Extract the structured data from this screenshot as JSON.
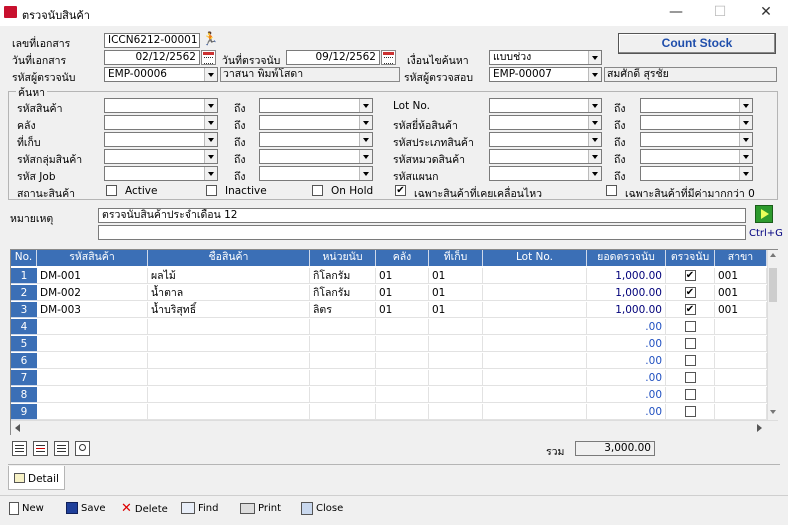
{
  "window": {
    "title": "ตรวจนับสินค้า",
    "minimize": "—",
    "maximize": "☐",
    "close": "✕"
  },
  "header": {
    "doc_no_label": "เลขที่เอกสาร",
    "doc_no": "ICCN6212-00001",
    "doc_date_label": "วันที่เอกสาร",
    "doc_date": "02/12/2562",
    "count_date_label": "วันที่ตรวจนับ",
    "count_date": "09/12/2562",
    "search_cond_label": "เงื่อนไขค้นหา",
    "search_cond": "แบบช่วง",
    "counter_label": "รหัสผู้ตรวจนับ",
    "counter_code": "EMP-00006",
    "counter_name": "วาสนา  พิมพ์โสดา",
    "checker_label": "รหัสผู้ตรวจสอบ",
    "checker_code": "EMP-00007",
    "checker_name": "สมศักดิ์  สุรชัย",
    "count_stock_button": "Count Stock"
  },
  "search": {
    "group_label": "ค้นหา",
    "to_label": "ถึง",
    "left_rows": [
      "รหัสสินค้า",
      "คลัง",
      "ที่เก็บ",
      "รหัสกลุ่มสินค้า",
      "รหัส Job"
    ],
    "right_rows": [
      "Lot No.",
      "รหัสยี่ห้อสินค้า",
      "รหัสประเภทสินค้า",
      "รหัสหมวดสินค้า",
      "รหัสแผนก"
    ],
    "status_label": "สถานะสินค้า",
    "checks": [
      {
        "label": "Active",
        "checked": false
      },
      {
        "label": "Inactive",
        "checked": false
      },
      {
        "label": "On Hold",
        "checked": false
      },
      {
        "label": "เฉพาะสินค้าที่เคยเคลื่อนไหว",
        "checked": true
      },
      {
        "label": "เฉพาะสินค้าที่มีค่ามากกว่า 0",
        "checked": false
      }
    ]
  },
  "remark": {
    "label": "หมายเหตุ",
    "line1": "ตรวจนับสินค้าประจำเดือน 12",
    "line2": "",
    "shortcut": "Ctrl+G"
  },
  "grid": {
    "columns": [
      "No.",
      "รหัสสินค้า",
      "ชื่อสินค้า",
      "หน่วยนับ",
      "คลัง",
      "ที่เก็บ",
      "Lot No.",
      "ยอดตรวจนับ",
      "ตรวจนับ",
      "สาขา"
    ],
    "rows": [
      {
        "no": "1",
        "code": "DM-001",
        "name": "ผลไม้",
        "unit": "กิโลกรัม",
        "wh": "01",
        "loc": "01",
        "lot": "",
        "qty": "1,000.00",
        "checked": true,
        "branch": "001"
      },
      {
        "no": "2",
        "code": "DM-002",
        "name": "น้ำตาล",
        "unit": "กิโลกรัม",
        "wh": "01",
        "loc": "01",
        "lot": "",
        "qty": "1,000.00",
        "checked": true,
        "branch": "001"
      },
      {
        "no": "3",
        "code": "DM-003",
        "name": "น้ำบริสุทธิ์",
        "unit": "ลิตร",
        "wh": "01",
        "loc": "01",
        "lot": "",
        "qty": "1,000.00",
        "checked": true,
        "branch": "001"
      },
      {
        "no": "4",
        "code": "",
        "name": "",
        "unit": "",
        "wh": "",
        "loc": "",
        "lot": "",
        "qty": ".00",
        "checked": false,
        "branch": ""
      },
      {
        "no": "5",
        "code": "",
        "name": "",
        "unit": "",
        "wh": "",
        "loc": "",
        "lot": "",
        "qty": ".00",
        "checked": false,
        "branch": ""
      },
      {
        "no": "6",
        "code": "",
        "name": "",
        "unit": "",
        "wh": "",
        "loc": "",
        "lot": "",
        "qty": ".00",
        "checked": false,
        "branch": ""
      },
      {
        "no": "7",
        "code": "",
        "name": "",
        "unit": "",
        "wh": "",
        "loc": "",
        "lot": "",
        "qty": ".00",
        "checked": false,
        "branch": ""
      },
      {
        "no": "8",
        "code": "",
        "name": "",
        "unit": "",
        "wh": "",
        "loc": "",
        "lot": "",
        "qty": ".00",
        "checked": false,
        "branch": ""
      },
      {
        "no": "9",
        "code": "",
        "name": "",
        "unit": "",
        "wh": "",
        "loc": "",
        "lot": "",
        "qty": ".00",
        "checked": false,
        "branch": ""
      }
    ],
    "total_label": "รวม",
    "total": "3,000.00"
  },
  "tabs": {
    "detail": "Detail"
  },
  "toolbar": {
    "new": "New",
    "save": "Save",
    "delete": "Delete",
    "find": "Find",
    "print": "Print",
    "close": "Close"
  }
}
